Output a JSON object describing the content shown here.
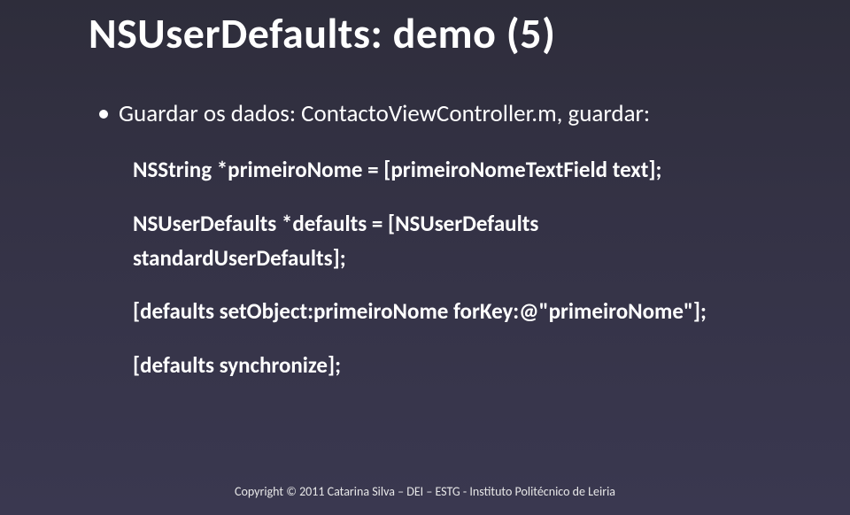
{
  "title": "NSUserDefaults: demo (5)",
  "bullet": "Guardar os dados: ContactoViewController.m, guardar:",
  "code": {
    "line1": "NSString *primeiroNome = [primeiroNomeTextField text];",
    "line2a": "NSUserDefaults *defaults = [NSUserDefaults",
    "line2b": "standardUserDefaults];",
    "line3": "[defaults setObject:primeiroNome forKey:@\"primeiroNome\"];",
    "line4": "[defaults synchronize];"
  },
  "footer": "Copyright © 2011 Catarina Silva – DEI – ESTG - Instituto Politécnico de Leiria"
}
